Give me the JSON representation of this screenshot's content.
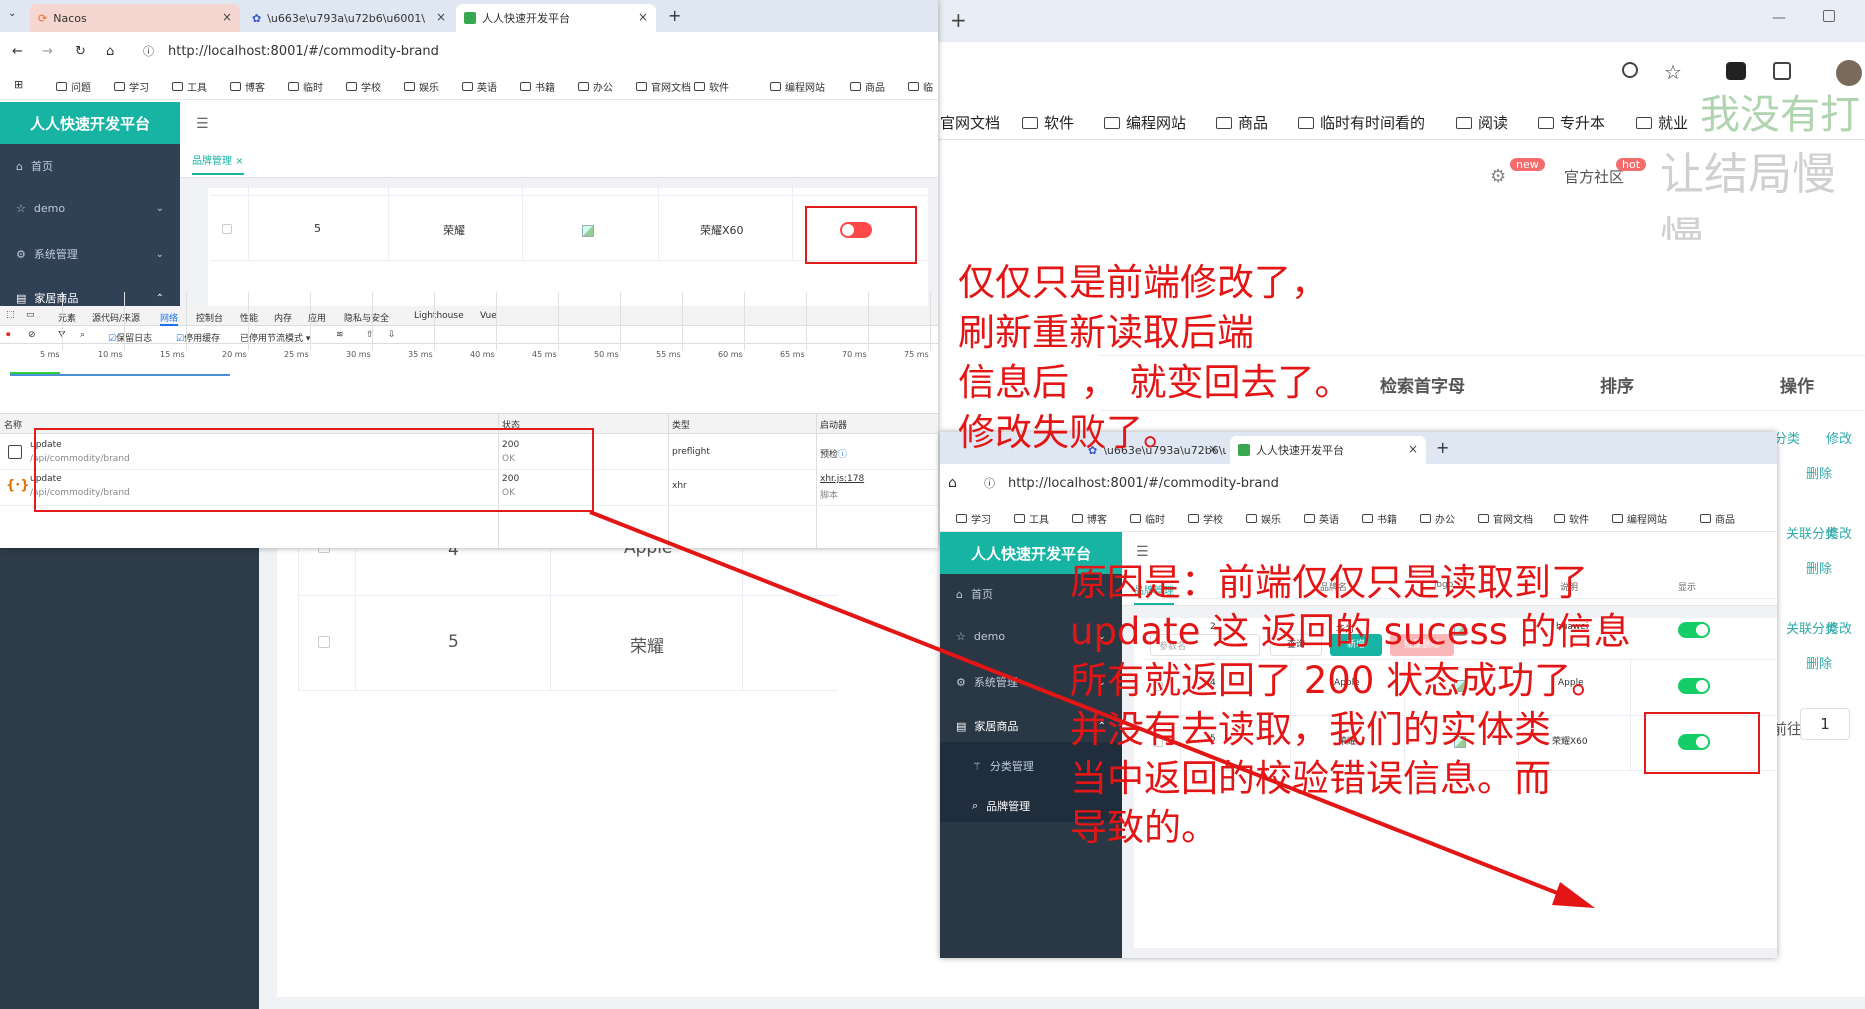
{
  "bg_window": {
    "plus_tab": "+",
    "bookmarks": [
      "官网文档",
      "软件",
      "编程网站",
      "商品",
      "临时有时间看的",
      "阅读",
      "专升本",
      "就业"
    ],
    "header": {
      "badge_new": "new",
      "badge_hot": "hot",
      "community": "官方社区"
    },
    "watermark": [
      "我没有打",
      "让结局慢慢"
    ],
    "table_headers": [
      "检索首字母",
      "排序",
      "操作"
    ],
    "row_links": {
      "cat": "关联分类",
      "edit": "修改",
      "del": "删除"
    },
    "rows": [
      {
        "id": "4",
        "name": "Apple"
      },
      {
        "id": "5",
        "name": "荣耀"
      }
    ],
    "pager": {
      "goto": "前往",
      "page": "1"
    }
  },
  "win1": {
    "tabs": [
      {
        "label": "Nacos",
        "icon": "nacos-icon"
      },
      {
        "label": "\\u663e\\u793a\\u72b6\\u6001\\",
        "icon": "baidu-paw-icon"
      },
      {
        "label": "人人快速开发平台",
        "icon": "renren-icon"
      }
    ],
    "tab_close": "×",
    "new_tab": "+",
    "url": "http://localhost:8001/#/commodity-brand",
    "bookmarks": [
      "问题",
      "学习",
      "工具",
      "博客",
      "临时",
      "学校",
      "娱乐",
      "英语",
      "书籍",
      "办公",
      "官网文档",
      "软件",
      "编程网站",
      "商品",
      "临"
    ],
    "app_title": "人人快速开发平台",
    "page_tab": "品牌管理",
    "page_tab_close": "×",
    "menu": [
      "首页",
      "demo",
      "系统管理",
      "家居商品"
    ],
    "row": {
      "id": "5",
      "name": "荣耀",
      "desc": "荣耀X60"
    },
    "devtools": {
      "tabs": [
        "元素",
        "源代码/来源",
        "网络",
        "控制台",
        "性能",
        "内存",
        "应用",
        "隐私与安全",
        "Lighthouse",
        "Vue"
      ],
      "toolbar": [
        "保留日志",
        "停用缓存",
        "已停用节流模式"
      ],
      "ticks": [
        "5 ms",
        "10 ms",
        "15 ms",
        "20 ms",
        "25 ms",
        "30 ms",
        "35 ms",
        "40 ms",
        "45 ms",
        "50 ms",
        "55 ms",
        "60 ms",
        "65 ms",
        "70 ms",
        "75 ms"
      ],
      "cols": [
        "名称",
        "状态",
        "类型",
        "启动器"
      ],
      "requests": [
        {
          "name": "update",
          "path": "/api/commodity/brand",
          "status": "200",
          "status_text": "OK",
          "type": "preflight",
          "initiator": "预检"
        },
        {
          "name": "update",
          "path": "/api/commodity/brand",
          "status": "200",
          "status_text": "OK",
          "type": "xhr",
          "initiator": "xhr.js:178",
          "initiator_sub": "脚本"
        }
      ]
    }
  },
  "win2": {
    "tabs": [
      {
        "label": "\\u663e\\u793a\\u72b6\\u6001\\",
        "icon": "baidu-paw-icon"
      },
      {
        "label": "人人快速开发平台",
        "icon": "renren-icon"
      }
    ],
    "tab_close": "×",
    "new_tab": "+",
    "url": "http://localhost:8001/#/commodity-brand",
    "bookmarks": [
      "学习",
      "工具",
      "博客",
      "临时",
      "学校",
      "娱乐",
      "英语",
      "书籍",
      "办公",
      "官网文档",
      "软件",
      "编程网站",
      "商品"
    ],
    "app_title": "人人快速开发平台",
    "page_tab": "品牌管理",
    "menu": [
      "首页",
      "demo",
      "系统管理",
      "家居商品",
      "分类管理",
      "品牌管理"
    ],
    "search_placeholder": "参数名",
    "buttons": [
      "查询",
      "新增",
      "批量删除"
    ],
    "cols": [
      "品牌名",
      "logo",
      "说明",
      "显示"
    ],
    "rows": [
      {
        "id": "2",
        "name": "华为",
        "desc": "huawei",
        "show": true
      },
      {
        "id": "4",
        "name": "Apple",
        "desc": "Apple",
        "show": true
      },
      {
        "id": "5",
        "name": "荣耀",
        "desc": "荣耀X60",
        "show": true
      }
    ]
  },
  "annotations": {
    "note1": [
      "仅仅只是前端修改了，",
      "刷新重新读取后端",
      "信息后 ， 就变回去了。",
      "修改失败了。"
    ],
    "note2": [
      "原因是：前端仅仅只是读取到了",
      "update 这 返回的 sucess 的信息",
      "所有就返回了 200 状态成功了。",
      "并没有去读取，我们的实体类",
      "当中返回的校验错误信息。而",
      "导致的。"
    ]
  },
  "colors": {
    "teal": "#17b3a3",
    "red_annotation": "#e31515",
    "switch_on": "#13ce66",
    "switch_off": "#ff4949"
  }
}
